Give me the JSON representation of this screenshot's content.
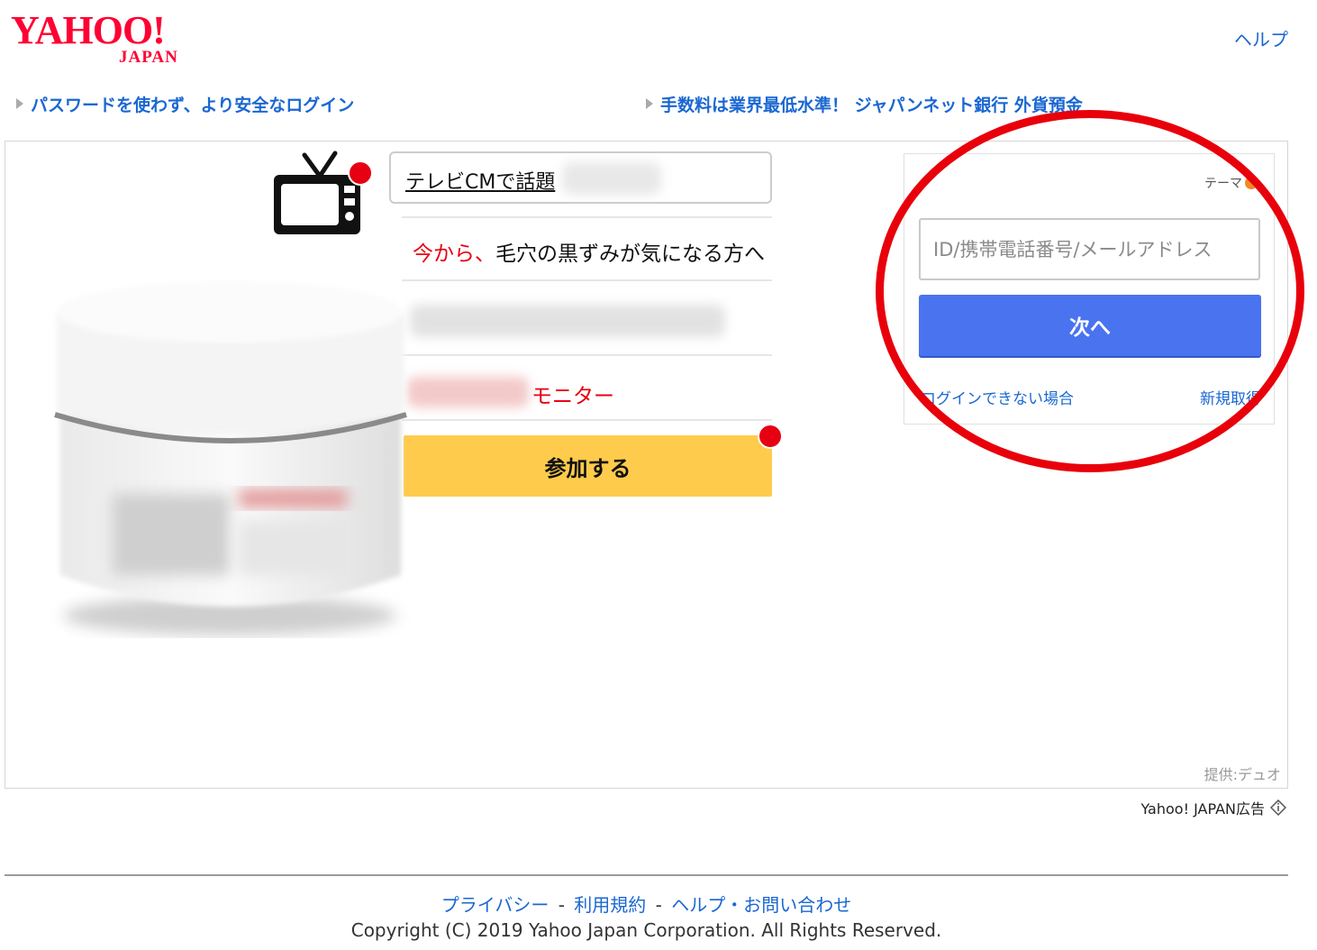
{
  "header": {
    "logo_main": "YAHOO!",
    "logo_sub": "JAPAN",
    "help_link": "ヘルプ"
  },
  "promos": [
    {
      "label": "パスワードを使わず、より安全なログイン"
    },
    {
      "label": "手数料は業界最低水準！ ジャパンネット銀行 外貨預金"
    }
  ],
  "ad": {
    "bubble_text": "テレビCMで話題",
    "row1_red": "今から、",
    "row1_dark": "毛穴の黒ずみが気になる方へ",
    "row3_red": "モニター",
    "join_button": "参加する",
    "provider": "提供:デュオ",
    "ad_label": "Yahoo! JAPAN広告"
  },
  "login": {
    "theme_label": "テーマ",
    "id_placeholder": "ID/携帯電話番号/メールアドレス",
    "next_button": "次へ",
    "cannot_login_link": "ログインできない場合",
    "register_link": "新規取得"
  },
  "footer": {
    "privacy": "プライバシー",
    "terms": "利用規約",
    "help_contact": "ヘルプ・お問い合わせ",
    "separator": "-",
    "copyright": "Copyright (C) 2019 Yahoo Japan Corporation. All Rights Reserved."
  },
  "colors": {
    "brand_red": "#ff0033",
    "link_blue": "#1a67d2",
    "next_button_blue": "#4a73f0",
    "join_button_yellow": "#ffcb4c",
    "highlight_ring_red": "#e8000b"
  }
}
